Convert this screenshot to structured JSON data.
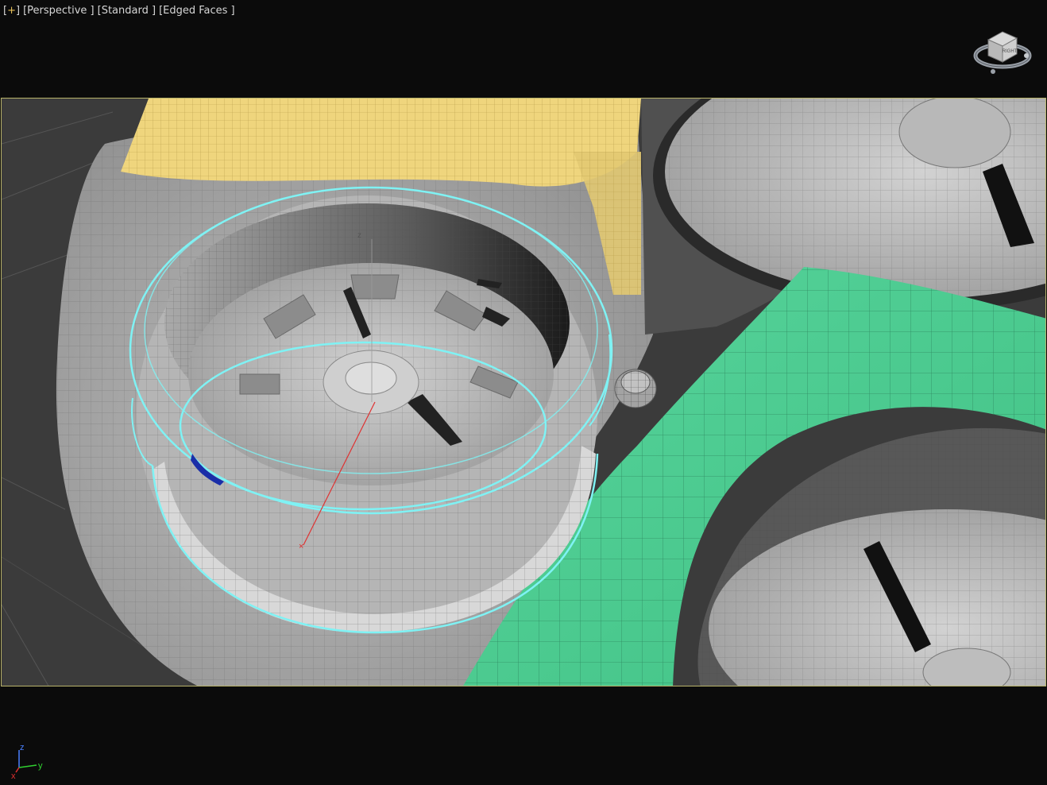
{
  "viewport": {
    "label_parts": [
      "+",
      "[Perspective ]",
      "[Standard ]",
      "[Edged Faces ]"
    ],
    "view_name": "Perspective",
    "shading": "Standard",
    "display_mode": "Edged Faces",
    "viewcube_face": "RIGHT",
    "tripod_axes": {
      "z": "z",
      "y": "y",
      "x": "x"
    },
    "gizmo_axis": "z"
  },
  "colors": {
    "background": "#0b0b0b",
    "safe_frame": "#b8b36a",
    "mesh_gray": "#a8a8a8",
    "wire": "#6f6f6f",
    "selection_cyan": "#7ff2f4",
    "green_object": "#4fcf93",
    "yellow_object": "#efd57d",
    "axis_x": "#e03030",
    "axis_y": "#30d030",
    "axis_z": "#4a80ff"
  }
}
